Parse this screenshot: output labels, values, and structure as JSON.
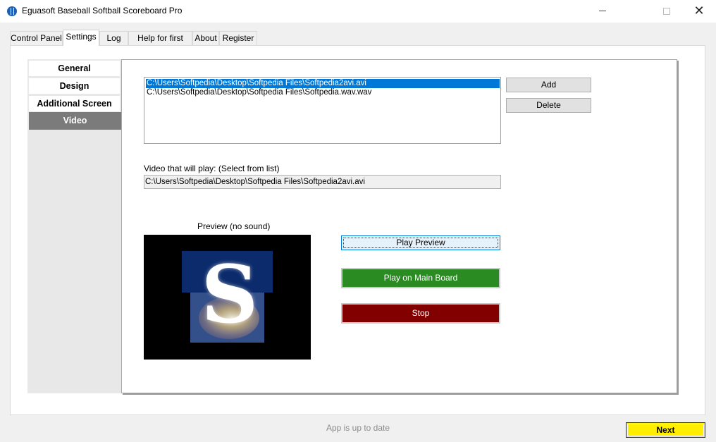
{
  "window": {
    "title": "Eguasoft Baseball Softball Scoreboard Pro"
  },
  "tabs": [
    {
      "label": "Control Panel"
    },
    {
      "label": "Settings"
    },
    {
      "label": "Log"
    },
    {
      "label": "Help for first step"
    },
    {
      "label": "About"
    },
    {
      "label": "Register"
    }
  ],
  "active_tab": "Settings",
  "sidebar": {
    "items": [
      {
        "label": "General"
      },
      {
        "label": "Design"
      },
      {
        "label": "Additional Screen"
      },
      {
        "label": "Video"
      }
    ],
    "active": "Video"
  },
  "video_list": {
    "items": [
      "C:\\Users\\Softpedia\\Desktop\\Softpedia Files\\Softpedia2avi.avi",
      "C:\\Users\\Softpedia\\Desktop\\Softpedia Files\\Softpedia.wav.wav"
    ],
    "selected_index": 0
  },
  "buttons": {
    "add": "Add",
    "delete": "Delete",
    "play_preview": "Play Preview",
    "play_main": "Play on Main Board",
    "stop": "Stop",
    "next": "Next"
  },
  "video_play": {
    "label": "Video that will play: (Select from list)",
    "value": "C:\\Users\\Softpedia\\Desktop\\Softpedia Files\\Softpedia2avi.avi"
  },
  "preview": {
    "label": "Preview (no sound)",
    "letter": "S"
  },
  "status": "App is up to date",
  "colors": {
    "selection": "#0078d7",
    "play_main": "#2a8b22",
    "stop": "#820000",
    "next": "#ffee00",
    "sidebar_active": "#7b7b7b"
  }
}
